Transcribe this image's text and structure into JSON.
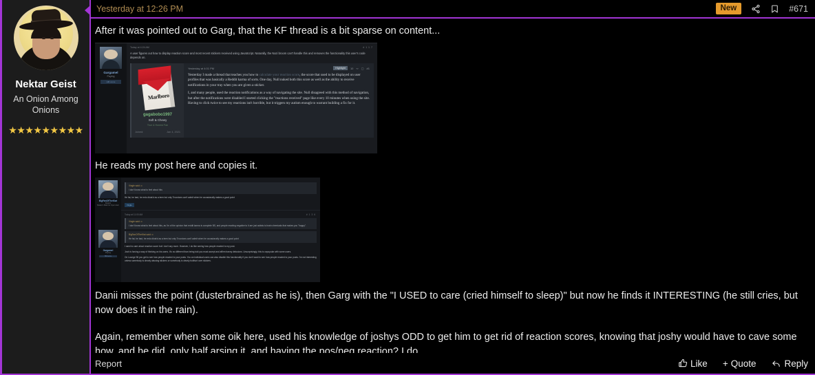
{
  "sidebar": {
    "username": "Nektar Geist",
    "user_title_line1": "An Onion Among",
    "user_title_line2": "Onions",
    "stars": "★★★★★★★★★",
    "avatar_name": "user-avatar-cowboy-hat"
  },
  "header": {
    "date": "Yesterday at 12:26 PM",
    "badge_new": "New",
    "post_number": "#671",
    "share_icon": "share-icon",
    "bookmark_icon": "bookmark-icon"
  },
  "body": {
    "paragraph1": "After it was pointed out to Garg, that the KF thread is a bit sparse on content...",
    "paragraph2": "He reads my post here and copies it.",
    "paragraph3": "Danii misses the point (dusterbrained as he is), then Garg with the \"I USED to care (cried himself to sleep)\" but now he finds it INTERESTING (he still cries, but now does it in the rain).",
    "paragraph4": "Again, remember when some oik here, used his knowledge of joshys ODD to get him to get rid of reaction scores, knowing that joshy would have to cave some how, and he did, only half arsing it, and having the pos/neg reaction? I do."
  },
  "embedded_image_1": {
    "alt": "embedded-forum-screenshot-reaction-score",
    "top_post": {
      "author": "Gargamel",
      "author_sub": "Paying",
      "author_chip": "HM score",
      "date": "Today at 4:24 AM",
      "post_number": "#117",
      "text": "A user figures out how to display reaction score and most recent stickers received using JavaScript. Naturally, the Nazi broom can't handle this and removes the functionality this user's code depends on."
    },
    "quote": {
      "author": "gagabobo1997",
      "author_title": "Soft & Chewy",
      "author_extra": "True & Honest Fan",
      "joined_label": "Joined:",
      "joined_date": "Jan 4, 2021",
      "date": "Yesterday at 4:01 PM",
      "highlight": "Highlight",
      "reaction_count": "10",
      "post_number": "#1",
      "avatar_alt": "marlboro-cigarette-pack-avatar",
      "brand_text": "Marlboro",
      "text_part1": "Yesterday I made a thread that teaches you how to ",
      "text_link": "calculate your reaction score",
      "text_part2": ", the score that used to be displayed on user profiles that was basically a Reddit karma of sorts. One day, Null nuked both this score as well as the ability to receive notifications in your tray when you are given a sticker.",
      "text_part3": "I, and many people, used the reaction notifications as a way of navigating the site. Null disagreed with this method of navigation, but after the notifications were disabled I started clicking the \"reactions received\" page like every 10 minutes when using the site. Having to click twice to see my reactions isn't horrible, but it triggers my autism enough to warrant building a fix for it."
    }
  },
  "embedded_image_2": {
    "alt": "embedded-forum-screenshot-quotes",
    "post_a": {
      "author": "BigFanOfTheKiwi",
      "author_sub": "Kiwami",
      "author_sub2": "Maker's Mark for Open Heir",
      "quote_header": "Vingle said: ⊙",
      "quote_text": "I don't know what to feel about this",
      "body_text": "He fat, he bad, he redo dlota'd as a teen but only Troonions can't admit when he occasionally makes a good point",
      "reaction": "Vingle"
    },
    "post_b": {
      "author": "Gargamel",
      "author_sub": "Paying",
      "author_chip": "HM score",
      "date": "Today at 11:00 AM",
      "post_number": "#136",
      "quote1_header": "Vingle said: ⊙",
      "quote1_text": "I don't know what to feel about this, as I'm of the opinion that reddit karma is complete BS, and people reacting negative to it are just autists to brain chemicals that makes you \"happy\".",
      "quote2_header": "BigFanOfTheKiwi said: ⊙",
      "quote2_text": "He fat, he bad, he redo dlota'd as a teen but only Troonions can't admit when he occasionally makes a good point",
      "line1": "I used to care about reaction score but I don't any more. However, I do like seeing how people reacted to my post.",
      "line2": "Josh is forcing a way of thinking on his users. It's no different than being told you must accept and affirm tranny delusions. Unsurprisingly, this is unpopular with some users.",
      "line3": "On Lounge 96 you get to see how people reacted to your posts. You an individual users can also disable this functionality if you don't want to see how people reacted to your posts. I'm not interesting unless somebody is clearly abusing stickers or somebody is clearly butthurt over stickers."
    }
  },
  "footer": {
    "report": "Report",
    "like": "Like",
    "quote": "Quote",
    "quote_prefix": "+",
    "reply": "Reply",
    "like_icon": "thumbs-up-icon",
    "reply_icon": "reply-arrow-icon"
  },
  "colors": {
    "accent_purple": "#a335d6",
    "badge_orange": "#e59a2c",
    "date_gold": "#b08c52",
    "star_gold": "#f2c744"
  }
}
